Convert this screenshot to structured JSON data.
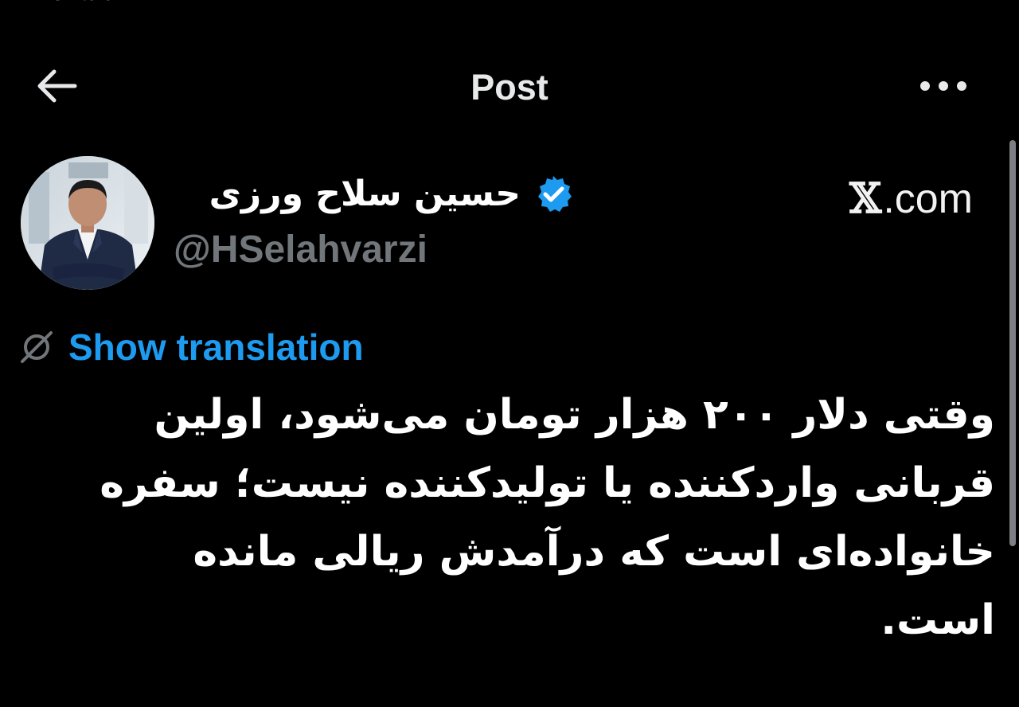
{
  "status_peek": "‹ Shafer",
  "header": {
    "title": "Post",
    "back_icon": "arrow-left-icon",
    "more_icon": "more-horizontal-icon"
  },
  "author": {
    "name": "حسین سلاح ورزی",
    "handle": "@HSelahvarzi",
    "verified": true,
    "verified_color": "#1d9bf0"
  },
  "source": {
    "label": ".com",
    "logo_letter": "𝕏"
  },
  "translation": {
    "label": "Show translation",
    "icon": "translate-off-icon",
    "color": "#1d9bf0"
  },
  "tweet": {
    "lines": [
      "وقتی دلار ۲۰۰ هزار تومان می‌شود، اولین",
      "قربانی واردکننده یا تولیدکننده نیست؛ سفره",
      "خانواده‌ای است که درآمدش ریالی مانده",
      "است."
    ]
  },
  "colors": {
    "background": "#000000",
    "text": "#e7e9ea",
    "muted": "#71767b",
    "accent": "#1d9bf0"
  }
}
